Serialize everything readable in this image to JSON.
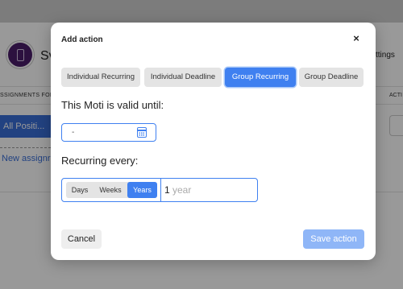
{
  "background": {
    "app_title": "Sv",
    "settings_label": "ttings",
    "section_label": "SSIGNMENTS FOR",
    "actions_label": "ACTI",
    "all_positions_label": "All Positi...",
    "new_assign_label": "New assignr"
  },
  "modal": {
    "title": "Add action",
    "close_icon": "×",
    "tabs": [
      {
        "label": "Individual Recurring",
        "active": false
      },
      {
        "label": "Individual Deadline",
        "active": false
      },
      {
        "label": "Group Recurring",
        "active": true
      },
      {
        "label": "Group Deadline",
        "active": false
      }
    ],
    "valid_until_label": "This Moti is valid until:",
    "date_value": "-",
    "recurring_label": "Recurring every:",
    "period_options": [
      {
        "label": "Days",
        "active": false
      },
      {
        "label": "Weeks",
        "active": false
      },
      {
        "label": "Years",
        "active": true
      }
    ],
    "recurring_count": "1",
    "recurring_unit": "year",
    "cancel_label": "Cancel",
    "save_label": "Save action"
  },
  "colors": {
    "accent": "#3f80f0",
    "save_disabled": "#8fb6f7"
  }
}
